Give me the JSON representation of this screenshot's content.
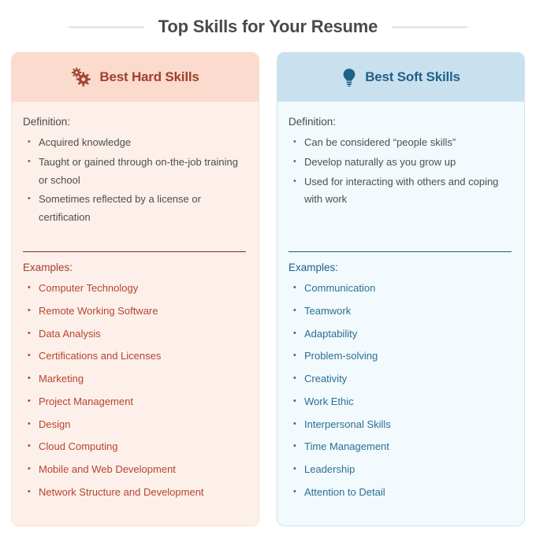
{
  "header": {
    "title": "Top Skills for Your Resume"
  },
  "cards": [
    {
      "id": "hard-skills",
      "icon": "gears-icon",
      "title": "Best Hard Skills",
      "definition_label": "Definition:",
      "definition_items": [
        "Acquired knowledge",
        "Taught or gained through on-the-job training or school",
        "Sometimes reflected by a license or certification"
      ],
      "examples_label": "Examples:",
      "examples_items": [
        "Computer Technology",
        "Remote Working Software",
        "Data Analysis",
        "Certifications and Licenses",
        "Marketing",
        "Project Management",
        "Design",
        "Cloud Computing",
        "Mobile and Web Development",
        "Network Structure and Development"
      ],
      "colors": {
        "header_bg": "#fadbcd",
        "body_bg": "#fdf0ea",
        "accent": "#b4452f",
        "divider": "#7e2f22"
      }
    },
    {
      "id": "soft-skills",
      "icon": "lightbulb-icon",
      "title": "Best Soft Skills",
      "definition_label": "Definition:",
      "definition_items": [
        "Can be considered “people skills”",
        "Develop naturally as you grow up",
        "Used for interacting with others and coping with work"
      ],
      "examples_label": "Examples:",
      "examples_items": [
        "Communication",
        "Teamwork",
        "Adaptability",
        "Problem-solving",
        "Creativity",
        "Work Ethic",
        "Interpersonal Skills",
        "Time Management",
        "Leadership",
        "Attention to Detail"
      ],
      "colors": {
        "header_bg": "#c9e0ef",
        "body_bg": "#f2fafd",
        "accent": "#2a6f93",
        "divider": "#1d5f7c"
      }
    }
  ]
}
